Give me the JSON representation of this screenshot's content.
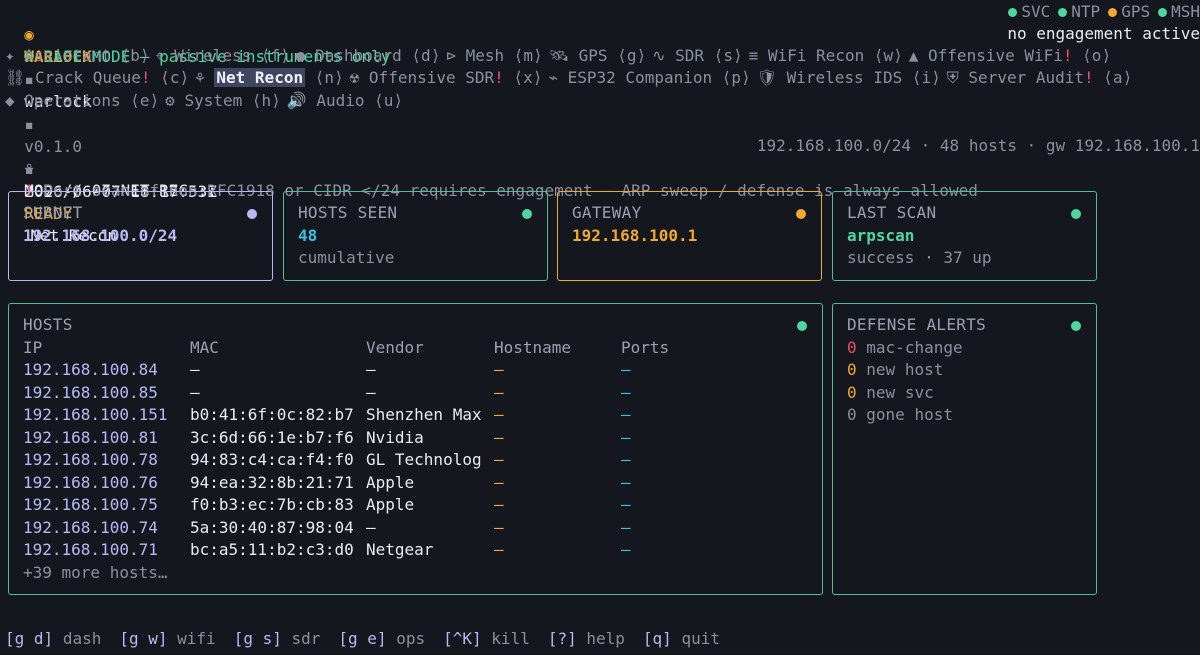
{
  "header": {
    "brand_icon": "radio-dot-icon",
    "brand": "WARLOCK",
    "host": "warlock",
    "version": "v0.1.0",
    "datetime": "2026-06-07 18:17:53Z",
    "sep": "▪",
    "status": [
      {
        "label": "SVC",
        "color": "#4fd6a0"
      },
      {
        "label": "NTP",
        "color": "#4fd6a0"
      },
      {
        "label": "GPS",
        "color": "#f0a92e"
      },
      {
        "label": "MSH",
        "color": "#4fd6a0"
      }
    ],
    "safe_icon": "©",
    "safe_mode": "SAFE MODE — passive instruments only",
    "engagement": "no engagement active"
  },
  "nav": [
    {
      "icon": "✦",
      "label": "Assistant",
      "key": "⟨b⟩",
      "danger": false,
      "active": false
    },
    {
      "icon": "⌖",
      "label": "Wireless",
      "key": "⟨f⟩",
      "danger": false,
      "active": false
    },
    {
      "icon": "●",
      "label": "Dashboard",
      "key": "⟨d⟩",
      "danger": false,
      "active": false
    },
    {
      "icon": "⊳",
      "label": "Mesh",
      "key": "⟨m⟩",
      "danger": false,
      "active": false
    },
    {
      "icon": "🛰",
      "label": "GPS",
      "key": "⟨g⟩",
      "danger": false,
      "active": false
    },
    {
      "icon": "∿",
      "label": "SDR",
      "key": "⟨s⟩",
      "danger": false,
      "active": false
    },
    {
      "icon": "≡",
      "label": "WiFi Recon",
      "key": "⟨w⟩",
      "danger": false,
      "active": false
    },
    {
      "icon": "▲",
      "label": "Offensive WiFi",
      "key": "⟨o⟩",
      "danger": true,
      "active": false
    },
    {
      "icon": "⛓",
      "label": "Crack Queue",
      "key": "⟨c⟩",
      "danger": true,
      "active": false
    },
    {
      "icon": "⚘",
      "label": "Net Recon",
      "key": "⟨n⟩",
      "danger": false,
      "active": true
    },
    {
      "icon": "☢",
      "label": "Offensive SDR",
      "key": "⟨x⟩",
      "danger": true,
      "active": false
    },
    {
      "icon": "⌁",
      "label": "ESP32 Companion",
      "key": "⟨p⟩",
      "danger": false,
      "active": false
    },
    {
      "icon": "🛡",
      "label": "Wireless IDS",
      "key": "⟨i⟩",
      "danger": false,
      "active": false
    },
    {
      "icon": "⛨",
      "label": "Server Audit",
      "key": "⟨a⟩",
      "danger": true,
      "active": false
    },
    {
      "icon": "◆",
      "label": "Operations",
      "key": "⟨e⟩",
      "danger": false,
      "active": false
    },
    {
      "icon": "⚙",
      "label": "System",
      "key": "⟨h⟩",
      "danger": false,
      "active": false
    },
    {
      "icon": "🔊",
      "label": "Audio",
      "key": "⟨u⟩",
      "danger": false,
      "active": false
    }
  ],
  "module": {
    "icon": "⚘",
    "prefix": "MOD // 07 NET-REC ::",
    "state": "READY",
    "title": "Net Recon",
    "summary": "192.168.100.0/24 · 48 hosts · gw 192.168.100.1",
    "warn_icon": "!",
    "warning": "Port scan of non-RFC1918 or CIDR </24 requires engagement — ARP sweep / defense is always allowed"
  },
  "cards": {
    "subnet": {
      "label": "SUBNET",
      "value": "192.168.100.0/24",
      "dot": "#b9b8f5"
    },
    "hosts_seen": {
      "label": "HOSTS SEEN",
      "value": "48",
      "sub": "cumulative",
      "dot": "#4fd6a0"
    },
    "gateway": {
      "label": "GATEWAY",
      "value": "192.168.100.1",
      "dot": "#f0a92e"
    },
    "last_scan": {
      "label": "LAST SCAN",
      "value": "arpscan",
      "sub": "success · 37 up",
      "dot": "#4fd6a0"
    }
  },
  "hosts": {
    "title": "HOSTS",
    "dot": "#4fd6a0",
    "columns": [
      "IP",
      "MAC",
      "Vendor",
      "Hostname",
      "Ports"
    ],
    "rows": [
      {
        "ip": "192.168.100.84",
        "mac": "—",
        "vendor": "—",
        "hostname": "—",
        "ports": "—"
      },
      {
        "ip": "192.168.100.85",
        "mac": "—",
        "vendor": "—",
        "hostname": "—",
        "ports": "—"
      },
      {
        "ip": "192.168.100.151",
        "mac": "b0:41:6f:0c:82:b7",
        "vendor": "Shenzhen Max",
        "hostname": "—",
        "ports": "—"
      },
      {
        "ip": "192.168.100.81",
        "mac": "3c:6d:66:1e:b7:f6",
        "vendor": "Nvidia",
        "hostname": "—",
        "ports": "—"
      },
      {
        "ip": "192.168.100.78",
        "mac": "94:83:c4:ca:f4:f0",
        "vendor": "GL Technolog",
        "hostname": "—",
        "ports": "—"
      },
      {
        "ip": "192.168.100.76",
        "mac": "94:ea:32:8b:21:71",
        "vendor": "Apple",
        "hostname": "—",
        "ports": "—"
      },
      {
        "ip": "192.168.100.75",
        "mac": "f0:b3:ec:7b:cb:83",
        "vendor": "Apple",
        "hostname": "—",
        "ports": "—"
      },
      {
        "ip": "192.168.100.74",
        "mac": "5a:30:40:87:98:04",
        "vendor": "—",
        "hostname": "—",
        "ports": "—"
      },
      {
        "ip": "192.168.100.71",
        "mac": "bc:a5:11:b2:c3:d0",
        "vendor": "Netgear",
        "hostname": "—",
        "ports": "—"
      }
    ],
    "more": "+39 more hosts…"
  },
  "alerts": {
    "title": "DEFENSE ALERTS",
    "dot": "#4fd6a0",
    "items": [
      {
        "count": "0",
        "label": "mac-change",
        "color": "#ef4f6b"
      },
      {
        "count": "0",
        "label": "new host",
        "color": "#f0a92e"
      },
      {
        "count": "0",
        "label": "new svc",
        "color": "#f0a92e"
      },
      {
        "count": "0",
        "label": "gone host",
        "color": "#8a90a0"
      }
    ]
  },
  "footer": [
    {
      "key": "[g d]",
      "label": "dash"
    },
    {
      "key": "[g w]",
      "label": "wifi"
    },
    {
      "key": "[g s]",
      "label": "sdr"
    },
    {
      "key": "[g e]",
      "label": "ops"
    },
    {
      "key": "[^K]",
      "label": "kill"
    },
    {
      "key": "[?]",
      "label": "help"
    },
    {
      "key": "[q]",
      "label": "quit"
    }
  ]
}
